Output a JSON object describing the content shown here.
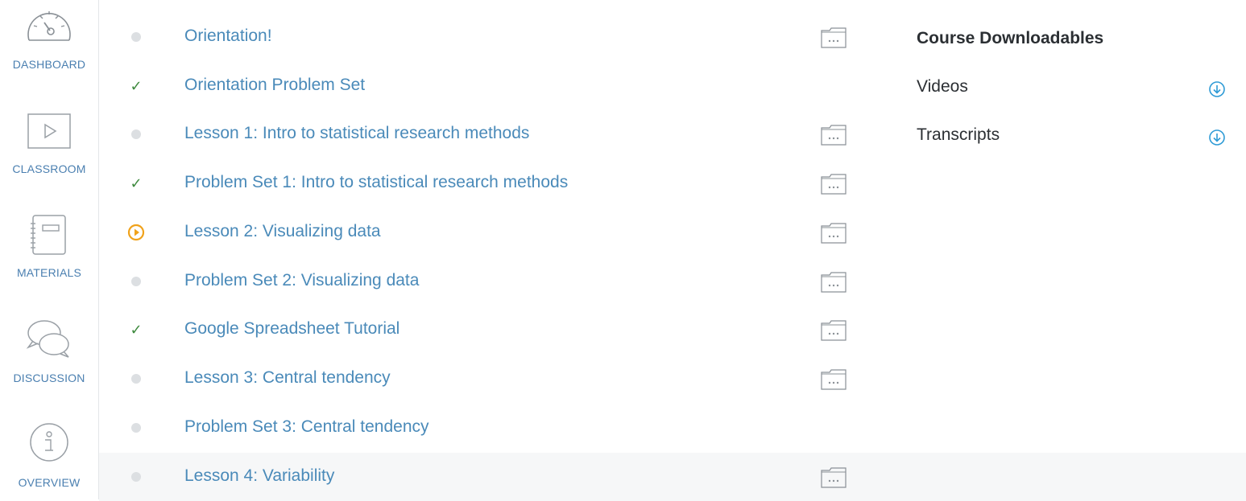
{
  "sidebar": {
    "items": [
      {
        "id": "dashboard",
        "label": "DASHBOARD",
        "icon": "gauge-icon"
      },
      {
        "id": "classroom",
        "label": "CLASSROOM",
        "icon": "play-icon"
      },
      {
        "id": "materials",
        "label": "MATERIALS",
        "icon": "notebook-icon"
      },
      {
        "id": "discussion",
        "label": "DISCUSSION",
        "icon": "chat-bubbles-icon"
      },
      {
        "id": "overview",
        "label": "OVERVIEW",
        "icon": "info-icon"
      }
    ]
  },
  "lessons": [
    {
      "title": "Orientation!",
      "status": "none",
      "has_folder": true
    },
    {
      "title": "Orientation Problem Set",
      "status": "complete",
      "has_folder": false
    },
    {
      "title": "Lesson 1: Intro to statistical research methods",
      "status": "none",
      "has_folder": true
    },
    {
      "title": "Problem Set 1: Intro to statistical research methods",
      "status": "complete",
      "has_folder": true
    },
    {
      "title": "Lesson 2: Visualizing data",
      "status": "in-progress",
      "has_folder": true
    },
    {
      "title": "Problem Set 2: Visualizing data",
      "status": "none",
      "has_folder": true
    },
    {
      "title": "Google Spreadsheet Tutorial",
      "status": "complete",
      "has_folder": true
    },
    {
      "title": "Lesson 3: Central tendency",
      "status": "none",
      "has_folder": true
    },
    {
      "title": "Problem Set 3: Central tendency",
      "status": "none",
      "has_folder": false
    },
    {
      "title": "Lesson 4: Variability",
      "status": "none",
      "has_folder": true
    }
  ],
  "downloads": {
    "heading": "Course Downloadables",
    "items": [
      {
        "label": "Videos",
        "icon": "download-icon"
      },
      {
        "label": "Transcripts",
        "icon": "download-icon"
      }
    ]
  },
  "colors": {
    "link": "#4a8ab9",
    "nav_label": "#4a7fb0",
    "check": "#3e8a3e",
    "in_progress": "#f0a21b",
    "dot": "#dcdfe2",
    "download": "#2f9bd6"
  }
}
